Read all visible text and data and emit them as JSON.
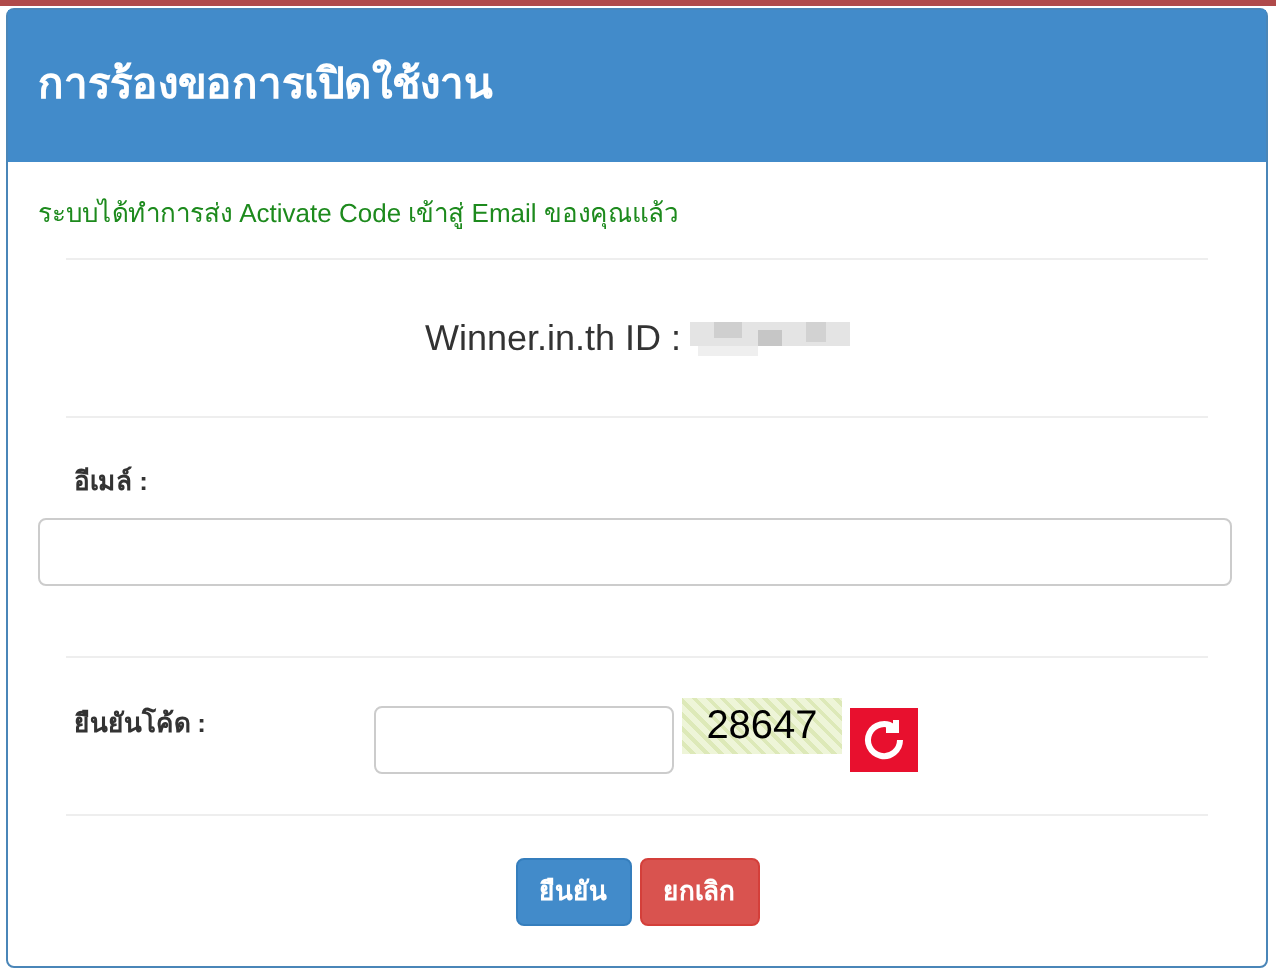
{
  "header": {
    "title": "การร้องขอการเปิดใช้งาน"
  },
  "message": "ระบบได้ทำการส่ง Activate Code เข้าสู่ Email ของคุณแล้ว",
  "account": {
    "label": "Winner.in.th ID :"
  },
  "email": {
    "label": "อีเมล์ :"
  },
  "captcha": {
    "label": "ยืนยันโค้ด :",
    "code": "28647"
  },
  "buttons": [
    {
      "label": "ยืนยัน",
      "kind": "primary"
    },
    {
      "label": "ยกเลิก",
      "kind": "danger"
    }
  ]
}
